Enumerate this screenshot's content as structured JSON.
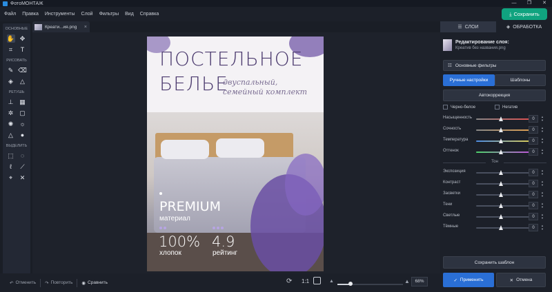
{
  "app": {
    "title": "ФотоМОНТАЖ",
    "save_label": "Сохранить"
  },
  "window_controls": {
    "minimize": "—",
    "maximize": "❐",
    "close": "✕"
  },
  "menu": [
    "Файл",
    "Правка",
    "Инструменты",
    "Слой",
    "Фильтры",
    "Вид",
    "Справка"
  ],
  "tools": {
    "sections": [
      "ОСНОВНЫЕ",
      "РИСОВАТЬ",
      "РЕТУШЬ",
      "ВЫДЕЛИТЬ"
    ],
    "icons": {
      "basic": [
        "hand-icon",
        "move-icon",
        "crop-icon",
        "text-icon"
      ],
      "draw": [
        "brush-icon",
        "eraser-icon",
        "fill-icon",
        "shapes-icon"
      ],
      "retouch": [
        "stamp-icon",
        "patch-icon",
        "blur-icon",
        "frame-icon",
        "brightness-icon",
        "sun-icon",
        "sharpen-icon",
        "drop-icon"
      ],
      "select": [
        "rect-select-icon",
        "ellipse-select-icon",
        "lasso-icon",
        "poly-lasso-icon",
        "magic-select-icon",
        "magic-wand-icon"
      ]
    }
  },
  "document_tab": {
    "name": "Креати...ия.png",
    "close": "×"
  },
  "poster": {
    "line1": "ПОСТЕЛЬНОЕ",
    "line2": "БЕЛЬЕ",
    "sub1": "двуспальный,",
    "sub2": "семейный комплект",
    "premium": "PREMIUM",
    "material": "материал",
    "stat1_value": "100%",
    "stat1_label": "хлопок",
    "stat2_value": "4.9",
    "stat2_label": "рейтинг"
  },
  "bottom": {
    "undo": "Отменить",
    "redo": "Повторить",
    "compare": "Сравнить",
    "ratio": "1:1",
    "zoom": "68%",
    "zoom_level": 0.2
  },
  "right_panel": {
    "tab_layers": "СЛОИ",
    "tab_processing": "ОБРАБОТКА",
    "layer_title": "Редактирование слоя:",
    "layer_name": "Креатив без названия.png",
    "basic_filters": "Основные фильтры",
    "manual_settings": "Ручные настройки",
    "templates": "Шаблоны",
    "auto_correction": "Автокоррекция",
    "bw": "Черно-белое",
    "negative": "Негатив",
    "tone_label": "Тон",
    "sliders_color": [
      {
        "label": "Насыщенность",
        "value": "0"
      },
      {
        "label": "Сочность",
        "value": "0"
      },
      {
        "label": "Температура",
        "value": "0"
      },
      {
        "label": "Оттенок",
        "value": "0"
      }
    ],
    "sliders_tone": [
      {
        "label": "Экспозиция",
        "value": "0"
      },
      {
        "label": "Контраст",
        "value": "0"
      },
      {
        "label": "Засветки",
        "value": "0"
      },
      {
        "label": "Тени",
        "value": "0"
      },
      {
        "label": "Светлые",
        "value": "0"
      },
      {
        "label": "Тёмные",
        "value": "0"
      }
    ],
    "save_template": "Сохранить шаблон",
    "apply": "Применить",
    "cancel": "Отмена"
  },
  "colors": {
    "accent_green": "#10a37f",
    "accent_blue": "#2a6fd6",
    "poster_title": "#4b3a6e"
  }
}
